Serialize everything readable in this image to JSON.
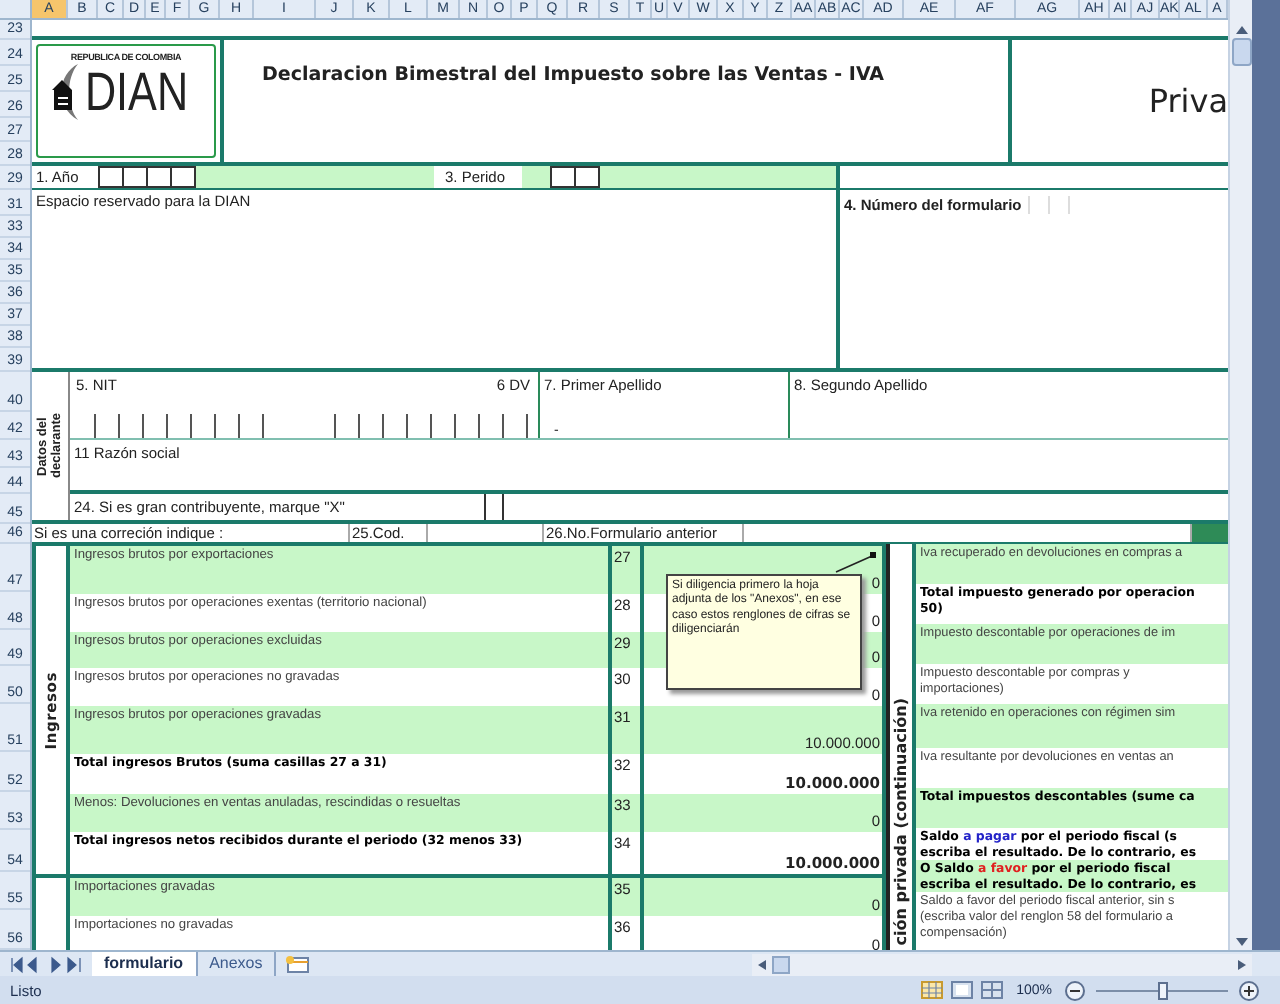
{
  "column_headers": [
    {
      "label": "A",
      "selected": true
    },
    {
      "label": "B",
      "selected": false
    },
    {
      "label": "C",
      "selected": false
    },
    {
      "label": "D",
      "selected": false
    },
    {
      "label": "E",
      "selected": false
    },
    {
      "label": "F",
      "selected": false
    },
    {
      "label": "G",
      "selected": false
    },
    {
      "label": "H",
      "selected": false
    },
    {
      "label": "I",
      "selected": false
    },
    {
      "label": "J",
      "selected": false
    },
    {
      "label": "K",
      "selected": false
    },
    {
      "label": "L",
      "selected": false
    },
    {
      "label": "M",
      "selected": false
    },
    {
      "label": "N",
      "selected": false
    },
    {
      "label": "O",
      "selected": false
    },
    {
      "label": "P",
      "selected": false
    },
    {
      "label": "Q",
      "selected": false
    },
    {
      "label": "R",
      "selected": false
    },
    {
      "label": "S",
      "selected": false
    },
    {
      "label": "T",
      "selected": false
    },
    {
      "label": "U",
      "selected": false
    },
    {
      "label": "V",
      "selected": false
    },
    {
      "label": "W",
      "selected": false
    },
    {
      "label": "X",
      "selected": false
    },
    {
      "label": "Y",
      "selected": false
    },
    {
      "label": "Z",
      "selected": false
    },
    {
      "label": "AA",
      "selected": false
    },
    {
      "label": "AB",
      "selected": false
    },
    {
      "label": "AC",
      "selected": false
    },
    {
      "label": "AD",
      "selected": false
    },
    {
      "label": "AE",
      "selected": false
    },
    {
      "label": "AF",
      "selected": false
    },
    {
      "label": "AG",
      "selected": false
    },
    {
      "label": "AH",
      "selected": false
    },
    {
      "label": "AI",
      "selected": false
    },
    {
      "label": "AJ",
      "selected": false
    },
    {
      "label": "AK",
      "selected": false
    },
    {
      "label": "AL",
      "selected": false
    },
    {
      "label": "A",
      "selected": false
    }
  ],
  "row_headers": [
    "23",
    "24",
    "25",
    "26",
    "27",
    "28",
    "29",
    "31",
    "33",
    "34",
    "35",
    "36",
    "37",
    "38",
    "39",
    "40",
    "42",
    "43",
    "44",
    "45",
    "46",
    "47",
    "48",
    "49",
    "50",
    "51",
    "52",
    "53",
    "54",
    "55",
    "56"
  ],
  "header": {
    "logo_top": "REPUBLICA DE COLOMBIA",
    "logo_name": "DIAN",
    "title": "Declaracion Bimestral del Impuesto sobre las Ventas - IVA",
    "title_right": "Priva"
  },
  "period_row": {
    "year_label": "1. Año",
    "period_label": "3. Perido"
  },
  "reserved": {
    "label": "Espacio reservado para la DIAN",
    "form_number_label": "4. Número del formulario"
  },
  "declarant": {
    "section_label": "Datos del declarante",
    "nit_label": "5.  NIT",
    "dv_label": "6  DV",
    "dv_value": "-",
    "first_surname_label": "7. Primer Apellido",
    "second_surname_label": "8. Segundo Apellido",
    "business_name_label": "11 Razón social",
    "large_taxpayer_label": "24. Si es gran contribuyente, marque \"X\""
  },
  "correction": {
    "label": "Si es una correción indique :",
    "code_label": "25.Cod.",
    "previous_form_label": "26.No.Formulario anterior"
  },
  "income_groups": [
    {
      "label": "Ingresos",
      "rows": [
        {
          "kind": "item",
          "label": "Ingresos brutos por exportaciones",
          "code": "27",
          "value": "0"
        },
        {
          "kind": "item",
          "label": "Ingresos brutos por operaciones exentas (territorio nacional)",
          "code": "28",
          "value": "0"
        },
        {
          "kind": "item",
          "label": "Ingresos brutos por operaciones excluidas",
          "code": "29",
          "value": "0"
        },
        {
          "kind": "item",
          "label": "Ingresos brutos por operaciones no gravadas",
          "code": "30",
          "value": "0"
        },
        {
          "kind": "item",
          "label": "Ingresos brutos por operaciones gravadas",
          "code": "31",
          "value": "10.000.000"
        },
        {
          "kind": "total",
          "label": "Total ingresos Brutos (suma casillas 27 a 31)",
          "code": "32",
          "value": "10.000.000"
        },
        {
          "kind": "item",
          "label": "Menos: Devoluciones en ventas anuladas, rescindidas o resueltas",
          "code": "33",
          "value": "0"
        },
        {
          "kind": "total",
          "label": "Total ingresos netos recibidos durante el periodo (32 menos 33)",
          "code": "34",
          "value": "10.000.000"
        }
      ]
    },
    {
      "rows": [
        {
          "kind": "item",
          "label": "Importaciones gravadas",
          "code": "35",
          "value": "0"
        },
        {
          "kind": "item",
          "label": "Importaciones no gravadas",
          "code": "36",
          "value": "0"
        }
      ]
    }
  ],
  "comment": {
    "text": "Si diligencia primero la hoja adjunta de los \"Anexos\", en ese caso estos renglones de cifras se diligenciarán"
  },
  "continuation_label": "ción privada (continuación)",
  "right_rows": [
    {
      "kind": "item",
      "lines": [
        [
          {
            "text": "Iva recuperado en devoluciones en compras a"
          }
        ]
      ]
    },
    {
      "kind": "total",
      "lines": [
        [
          {
            "text": "Total impuesto generado por operacion"
          }
        ],
        [
          {
            "text": "50)"
          }
        ]
      ]
    },
    {
      "kind": "item",
      "lines": [
        [
          {
            "text": "Impuesto descontable por operaciones de im"
          }
        ]
      ]
    },
    {
      "kind": "item",
      "lines": [
        [
          {
            "text": "Impuesto  descontable  por  compras  y"
          }
        ],
        [
          {
            "text": "importaciones)"
          }
        ]
      ]
    },
    {
      "kind": "item",
      "lines": [
        [
          {
            "text": "Iva retenido en operaciones con régimen sim"
          }
        ]
      ]
    },
    {
      "kind": "item",
      "lines": [
        [
          {
            "text": "Iva resultante por devoluciones en ventas an"
          }
        ]
      ]
    },
    {
      "kind": "total",
      "lines": [
        [
          {
            "text": "Total impuestos descontables (sume ca"
          }
        ]
      ]
    },
    {
      "kind": "total",
      "lines": [
        [
          {
            "text": "Saldo "
          },
          {
            "text": "a pagar",
            "color": "#2424c8"
          },
          {
            "text": " por el periodo fiscal  (s"
          }
        ],
        [
          {
            "text": "escriba el resultado. De lo contrario, es"
          }
        ]
      ]
    },
    {
      "kind": "total",
      "lines": [
        [
          {
            "text": "O Saldo "
          },
          {
            "text": "a favor",
            "color": "#e02020"
          },
          {
            "text": " por el periodo fiscal"
          }
        ],
        [
          {
            "text": "escriba el resultado. De lo contrario, es"
          }
        ]
      ]
    },
    {
      "kind": "item",
      "lines": [
        [
          {
            "text": "Saldo a favor del periodo fiscal anterior, sin s"
          }
        ],
        [
          {
            "text": "(escriba valor del renglon 58 del formulario a"
          }
        ],
        [
          {
            "text": "compensación)"
          }
        ]
      ]
    }
  ],
  "sheet_tabs": [
    {
      "label": "formulario",
      "selected": true
    },
    {
      "label": "Anexos",
      "selected": false
    }
  ],
  "status_bar": {
    "text": "Listo",
    "zoom": "100%",
    "zoom_slider": {
      "level": 0.5
    }
  }
}
